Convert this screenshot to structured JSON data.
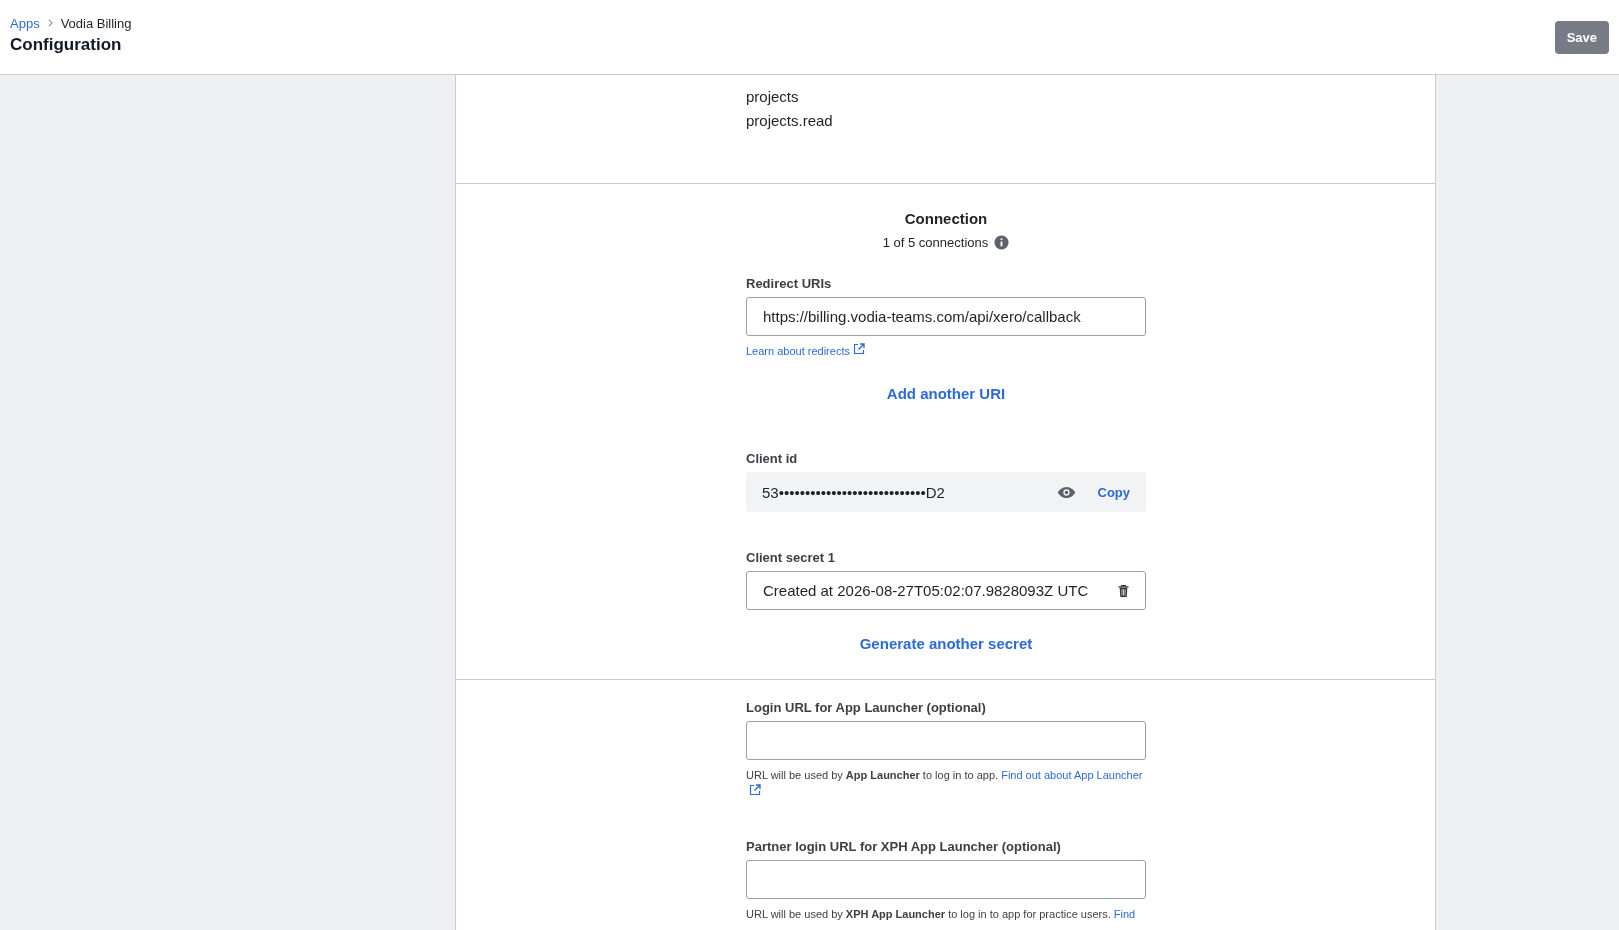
{
  "header": {
    "breadcrumb": [
      {
        "label": "Apps",
        "kind": "link"
      },
      {
        "label": "Vodia Billing",
        "kind": "current"
      }
    ],
    "title": "Configuration",
    "save_button": "Save"
  },
  "scopes": [
    "projects",
    "projects.read"
  ],
  "connection": {
    "title": "Connection",
    "count": "1 of 5 connections",
    "redirect_label": "Redirect URIs",
    "redirect_value": "https://billing.vodia-teams.com/api/xero/callback",
    "learn_link": "Learn about redirects",
    "add_uri": "Add another URI",
    "client_id_label": "Client id",
    "client_id": "53••••••••••••••••••••••••••••D2",
    "copy": "Copy",
    "secret_label": "Client secret 1",
    "secret_value": "Created at 2026-08-27T05:02:07.9828093Z UTC",
    "generate": "Generate another secret"
  },
  "launcher": [
    {
      "label": "Login URL for App Launcher (optional)",
      "help": "URL will be used by **App Launcher** to log in to app.",
      "link": "Find out about App Launcher",
      "link_icon": true
    },
    {
      "label": "Partner login URL for XPH App Launcher (optional)",
      "help": "URL will be used by **XPH App Launcher** to log in to app for practice users.",
      "link": "Find",
      "link_icon": false
    }
  ]
}
